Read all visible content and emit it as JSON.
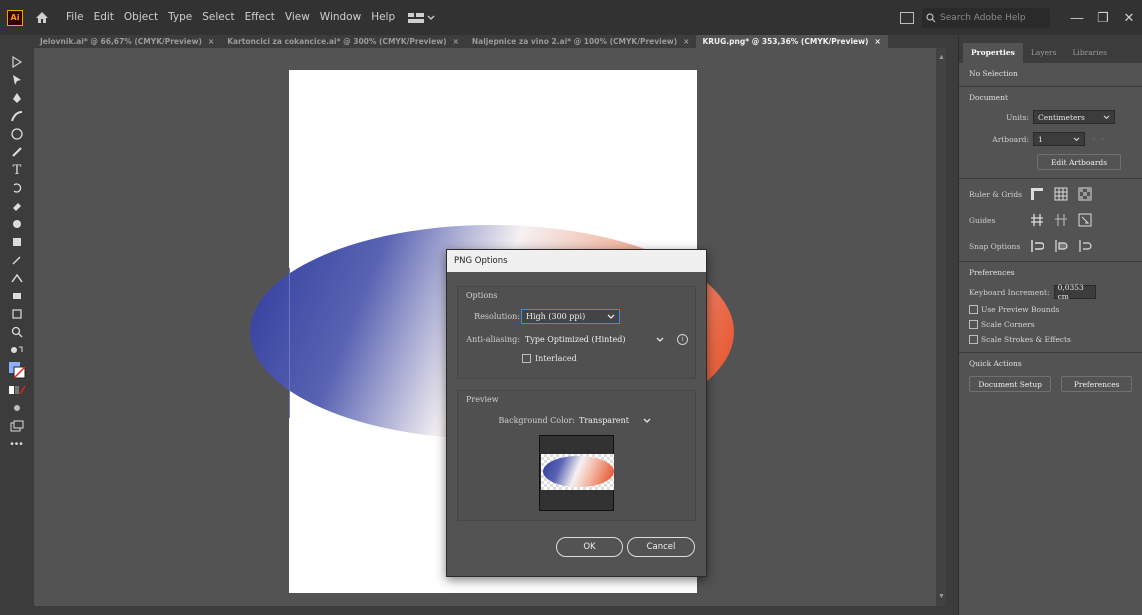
{
  "app": {
    "logo_text": "Ai",
    "menu": [
      "File",
      "Edit",
      "Object",
      "Type",
      "Select",
      "Effect",
      "View",
      "Window",
      "Help"
    ],
    "search_placeholder": "Search Adobe Help"
  },
  "tabs": [
    {
      "label": "Jelovnik.ai* @ 66,67% (CMYK/Preview)",
      "active": false
    },
    {
      "label": "Kartoncici za cokancice.ai* @ 300% (CMYK/Preview)",
      "active": false
    },
    {
      "label": "Naljepnice za vino 2.ai* @ 100% (CMYK/Preview)",
      "active": false
    },
    {
      "label": "KRUG.png* @ 353,36% (CMYK/Preview)",
      "active": true
    }
  ],
  "tab_close": "×",
  "properties": {
    "tabs": [
      "Properties",
      "Layers",
      "Libraries"
    ],
    "selection": "No Selection",
    "document_label": "Document",
    "units_label": "Units:",
    "units_value": "Centimeters",
    "artboard_label": "Artboard:",
    "artboard_value": "1",
    "edit_artboards": "Edit Artboards",
    "ruler_grids": "Ruler & Grids",
    "guides": "Guides",
    "snap_options": "Snap Options",
    "preferences_label": "Preferences",
    "keyboard_increment_label": "Keyboard Increment:",
    "keyboard_increment_value": "0,0353 cm",
    "use_preview_bounds": "Use Preview Bounds",
    "scale_corners": "Scale Corners",
    "scale_strokes": "Scale Strokes & Effects",
    "quick_actions": "Quick Actions",
    "document_setup": "Document Setup",
    "preferences_button": "Preferences"
  },
  "dialog": {
    "title": "PNG Options",
    "options_group": "Options",
    "resolution_label": "Resolution:",
    "resolution_value": "High (300 ppi)",
    "antialiasing_label": "Anti-aliasing:",
    "antialiasing_value": "Type Optimized (Hinted)",
    "interlaced_label": "Interlaced",
    "interlaced_checked": false,
    "preview_group": "Preview",
    "background_label": "Background Color:",
    "background_value": "Transparent",
    "ok": "OK",
    "cancel": "Cancel"
  },
  "colors": {
    "accent": "#3b8ee8",
    "gradient_blue": "#2e3a9c",
    "gradient_red": "#e4441b"
  },
  "icons": {
    "home": "home-icon",
    "info": "info-icon",
    "chevron": "chevron-down-icon"
  }
}
